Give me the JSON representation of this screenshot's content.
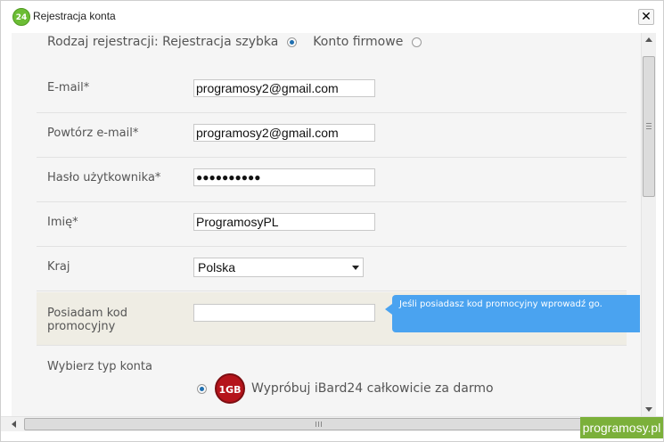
{
  "window": {
    "title": "Rejestracja konta",
    "app_icon_text": "24",
    "close_glyph": "✕"
  },
  "registration_type": {
    "label": "Rodzaj rejestracji:",
    "options": [
      {
        "label": "Rejestracja szybka",
        "selected": true
      },
      {
        "label": "Konto firmowe",
        "selected": false
      }
    ]
  },
  "form": {
    "email": {
      "label": "E-mail*",
      "value": "programosy2@gmail.com"
    },
    "email_repeat": {
      "label": "Powtórz e-mail*",
      "value": "programosy2@gmail.com"
    },
    "password": {
      "label": "Hasło użytkownika*",
      "value": "●●●●●●●●●●"
    },
    "first_name": {
      "label": "Imię*",
      "value": "ProgramosyPL"
    },
    "country": {
      "label": "Kraj",
      "value": "Polska"
    },
    "promo_code": {
      "label": "Posiadam kod promocyjny",
      "value": "",
      "tooltip": "Jeśli posiadasz kod promocyjny wprowadź go."
    },
    "account_type": {
      "label": "Wybierz typ konta",
      "options": [
        {
          "badge": "1GB",
          "label": "Wypróbuj iBard24 całkowicie za darmo",
          "selected": true
        }
      ]
    }
  },
  "watermark": "programosy.pl",
  "colors": {
    "accent_radio": "#1f6fb0",
    "tooltip_bg": "#4aa3f0",
    "promo_row_bg": "#efede4",
    "badge_red": "#b5141b",
    "watermark_green": "#7bb03a"
  }
}
